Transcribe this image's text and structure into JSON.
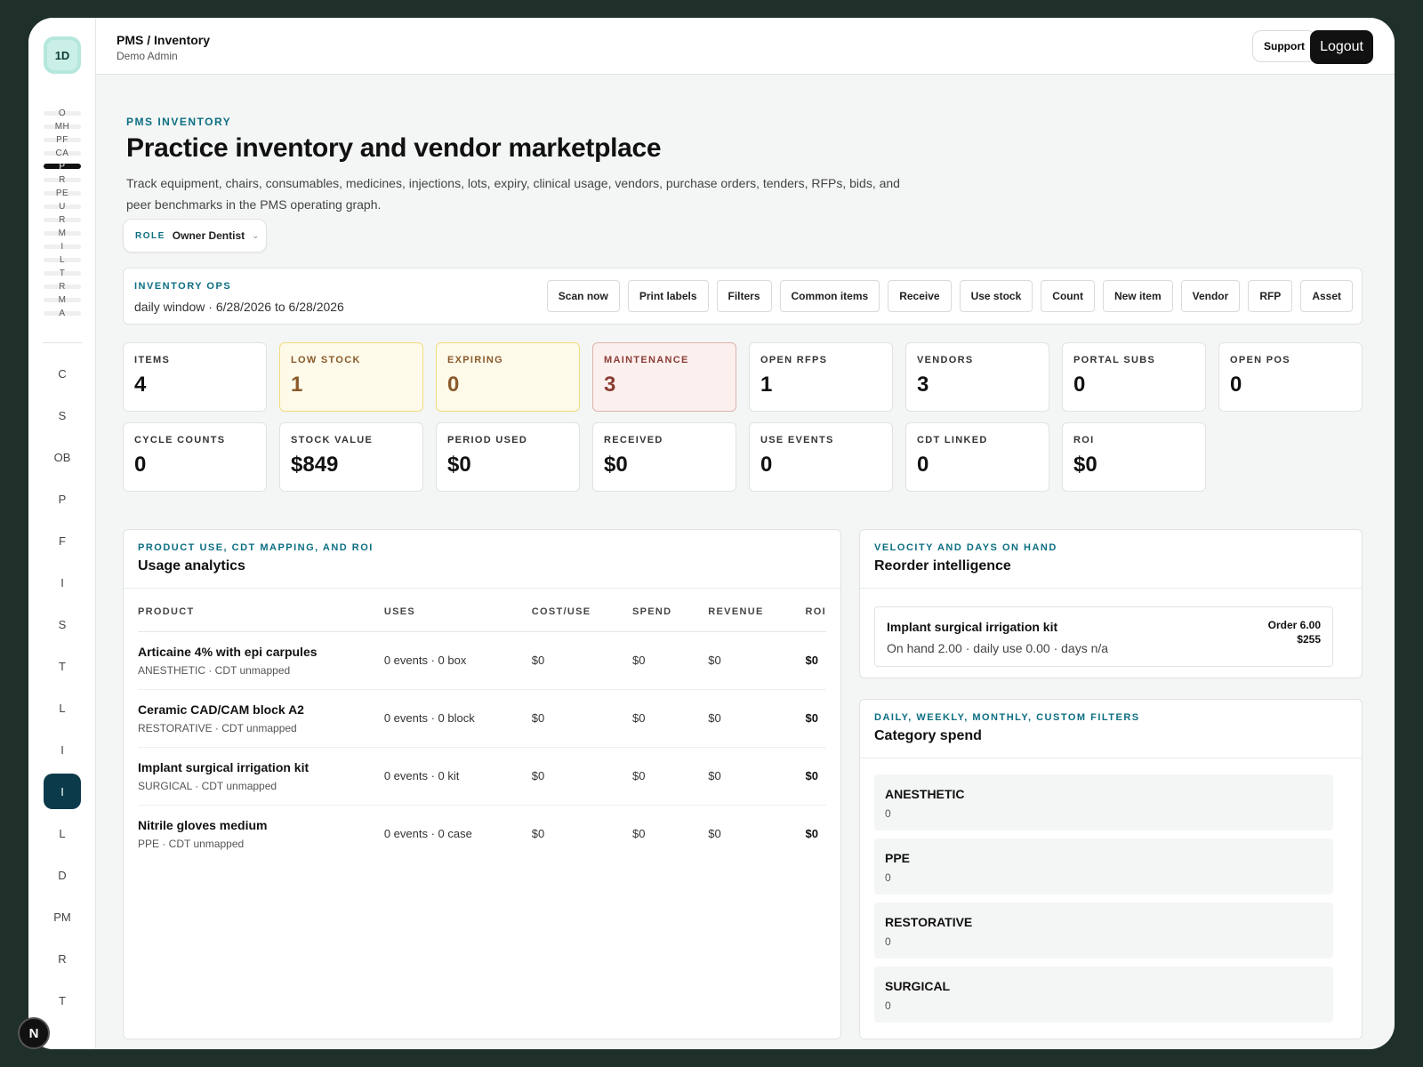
{
  "app": {
    "logo": "1D",
    "breadcrumb": "PMS / Inventory",
    "user": "Demo Admin",
    "support_label": "Support",
    "logout_label": "Logout",
    "badge": "N"
  },
  "mini_nav": [
    "O",
    "MH",
    "PF",
    "CA",
    "P",
    "R",
    "PE",
    "U",
    "R",
    "M",
    "I",
    "L",
    "T",
    "R",
    "M",
    "A"
  ],
  "side_nav": [
    "C",
    "S",
    "OB",
    "P",
    "F",
    "I",
    "S",
    "T",
    "L",
    "I",
    "I",
    "L",
    "D",
    "PM",
    "R",
    "T"
  ],
  "header": {
    "eyebrow": "PMS INVENTORY",
    "title": "Practice inventory and vendor marketplace",
    "description": "Track equipment, chairs, consumables, medicines, injections, lots, expiry, clinical usage, vendors, purchase orders, tenders, RFPs, bids, and peer benchmarks in the PMS operating graph."
  },
  "role": {
    "label": "ROLE",
    "value": "Owner Dentist",
    "chevron": "⌄"
  },
  "ops": {
    "eyebrow": "INVENTORY OPS",
    "window": "daily window · 6/28/2026 to 6/28/2026",
    "buttons": [
      "Scan now",
      "Print labels",
      "Filters",
      "Common items",
      "Receive",
      "Use stock",
      "Count",
      "New item",
      "Vendor",
      "RFP",
      "Asset"
    ]
  },
  "stats": [
    {
      "label": "ITEMS",
      "value": "4"
    },
    {
      "label": "LOW STOCK",
      "value": "1"
    },
    {
      "label": "EXPIRING",
      "value": "0"
    },
    {
      "label": "MAINTENANCE",
      "value": "3"
    },
    {
      "label": "OPEN RFPS",
      "value": "1"
    },
    {
      "label": "VENDORS",
      "value": "3"
    },
    {
      "label": "PORTAL SUBS",
      "value": "0"
    },
    {
      "label": "OPEN POS",
      "value": "0"
    },
    {
      "label": "CYCLE COUNTS",
      "value": "0"
    },
    {
      "label": "STOCK VALUE",
      "value": "$849"
    },
    {
      "label": "PERIOD USED",
      "value": "$0"
    },
    {
      "label": "RECEIVED",
      "value": "$0"
    },
    {
      "label": "USE EVENTS",
      "value": "0"
    },
    {
      "label": "CDT LINKED",
      "value": "0"
    },
    {
      "label": "ROI",
      "value": "$0"
    }
  ],
  "usage": {
    "eyebrow": "PRODUCT USE, CDT MAPPING, AND ROI",
    "title": "Usage analytics",
    "columns": [
      "PRODUCT",
      "USES",
      "COST/USE",
      "SPEND",
      "REVENUE",
      "ROI"
    ],
    "rows": [
      {
        "name": "Articaine 4% with epi carpules",
        "meta": "ANESTHETIC · CDT unmapped",
        "uses": "0 events · 0 box",
        "cost": "$0",
        "spend": "$0",
        "revenue": "$0",
        "roi": "$0"
      },
      {
        "name": "Ceramic CAD/CAM block A2",
        "meta": "RESTORATIVE · CDT unmapped",
        "uses": "0 events · 0 block",
        "cost": "$0",
        "spend": "$0",
        "revenue": "$0",
        "roi": "$0"
      },
      {
        "name": "Implant surgical irrigation kit",
        "meta": "SURGICAL · CDT unmapped",
        "uses": "0 events · 0 kit",
        "cost": "$0",
        "spend": "$0",
        "revenue": "$0",
        "roi": "$0"
      },
      {
        "name": "Nitrile gloves medium",
        "meta": "PPE · CDT unmapped",
        "uses": "0 events · 0 case",
        "cost": "$0",
        "spend": "$0",
        "revenue": "$0",
        "roi": "$0"
      }
    ]
  },
  "reorder": {
    "eyebrow": "VELOCITY AND DAYS ON HAND",
    "title": "Reorder intelligence",
    "item": {
      "name": "Implant surgical irrigation kit",
      "meta": "On hand 2.00 · daily use 0.00 · days n/a",
      "order": "Order 6.00",
      "price": "$255"
    }
  },
  "category": {
    "eyebrow": "DAILY, WEEKLY, MONTHLY, CUSTOM FILTERS",
    "title": "Category spend",
    "items": [
      {
        "name": "ANESTHETIC",
        "value": "0"
      },
      {
        "name": "PPE",
        "value": "0"
      },
      {
        "name": "RESTORATIVE",
        "value": "0"
      },
      {
        "name": "SURGICAL",
        "value": "0"
      }
    ]
  }
}
